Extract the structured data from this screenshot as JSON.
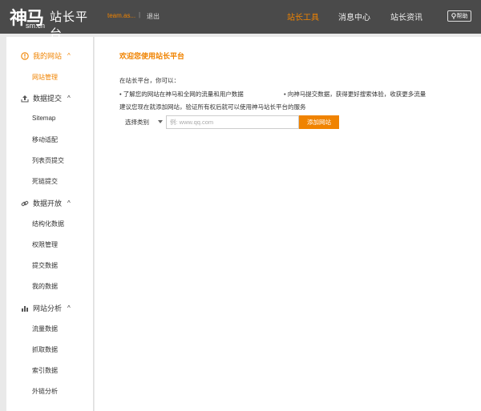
{
  "header": {
    "logo_main": "神马",
    "logo_sub": "sm.cn",
    "logo_title": "站长平台",
    "user": "team.as...",
    "separator": "|",
    "logout": "退出",
    "nav": [
      {
        "label": "站长工具",
        "active": true
      },
      {
        "label": "消息中心",
        "active": false
      },
      {
        "label": "站长资讯",
        "active": false
      }
    ],
    "help": "帮助"
  },
  "sidebar": {
    "sections": [
      {
        "icon": "info-icon",
        "label": "我的网站",
        "active": true,
        "items": [
          "网站管理"
        ]
      },
      {
        "icon": "upload-icon",
        "label": "数据提交",
        "active": false,
        "items": [
          "Sitemap",
          "移动适配",
          "列表页提交",
          "死链提交"
        ]
      },
      {
        "icon": "link-icon",
        "label": "数据开放",
        "active": false,
        "items": [
          "结构化数据",
          "权限管理",
          "提交数据",
          "我的数据"
        ]
      },
      {
        "icon": "bar-chart-icon",
        "label": "网站分析",
        "active": false,
        "items": [
          "流量数据",
          "抓取数据",
          "索引数据",
          "外链分析"
        ]
      }
    ]
  },
  "main": {
    "welcome": "欢迎您使用站长平台",
    "intro": "在站长平台，你可以：",
    "bullet1": "• 了解您的网站在神马和全网的流量和用户数据",
    "bullet2": "• 向神马提交数据，获得更好搜索体验，收获更多流量",
    "suggest": "建议您现在就添加网站，验证所有权后就可以使用神马站长平台的服务",
    "select_value": "选择类别",
    "input_placeholder": "例: www.qq.com",
    "add_button": "添加网站"
  },
  "colors": {
    "accent": "#f08300",
    "header_bg": "#4a4a4a",
    "page_bg": "#e9e9e9"
  }
}
